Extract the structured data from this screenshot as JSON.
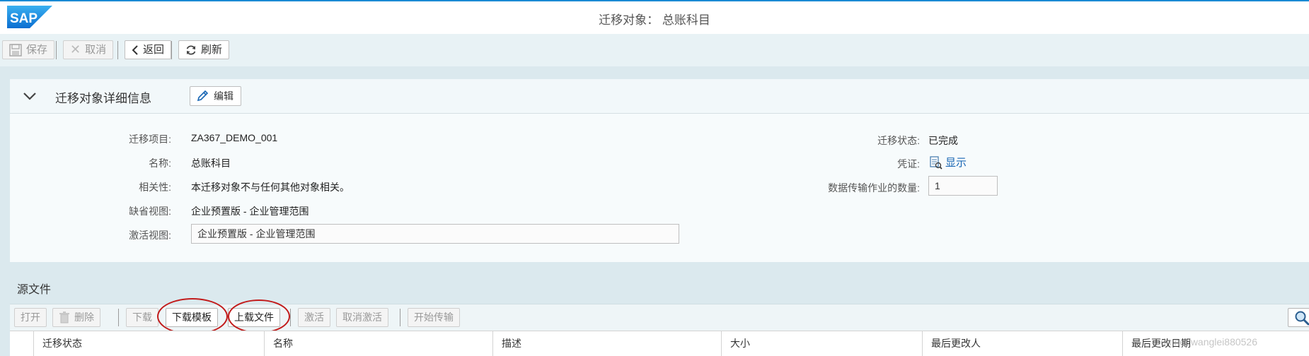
{
  "shell": {
    "logo_text": "SAP",
    "title": "迁移对象：  总账科目"
  },
  "toolbar": {
    "save": "保存",
    "cancel": "取消",
    "back": "返回",
    "refresh": "刷新"
  },
  "details": {
    "title": "迁移对象详细信息",
    "edit": "编辑",
    "left": [
      {
        "label": "迁移项目:",
        "value": "ZA367_DEMO_001"
      },
      {
        "label": "名称:",
        "value": "总账科目"
      },
      {
        "label": "相关性:",
        "value": "本迁移对象不与任何其他对象相关。"
      },
      {
        "label": "缺省视图:",
        "value": "企业预置版 - 企业管理范围"
      },
      {
        "label": "激活视图:",
        "value": "企业预置版 - 企业管理范围"
      }
    ],
    "right": [
      {
        "label": "迁移状态:",
        "value": "已完成"
      },
      {
        "label": "凭证:",
        "value": "显示"
      },
      {
        "label": "数据传输作业的数量:",
        "value": "1"
      }
    ]
  },
  "source": {
    "title": "源文件",
    "buttons": {
      "open": "打开",
      "delete": "删除",
      "download": "下载",
      "download_template": "下载模板",
      "upload_file": "上载文件",
      "activate": "激活",
      "deactivate": "取消激活",
      "start_transfer": "开始传输"
    },
    "columns": [
      "迁移状态",
      "名称",
      "描述",
      "大小",
      "最后更改人",
      "最后更改日期"
    ]
  },
  "watermark": "dn.net/wanglei880526",
  "colors": {
    "accent": "#1a8ad4",
    "link": "#1866b4",
    "highlight_ring": "#c21b1b"
  }
}
